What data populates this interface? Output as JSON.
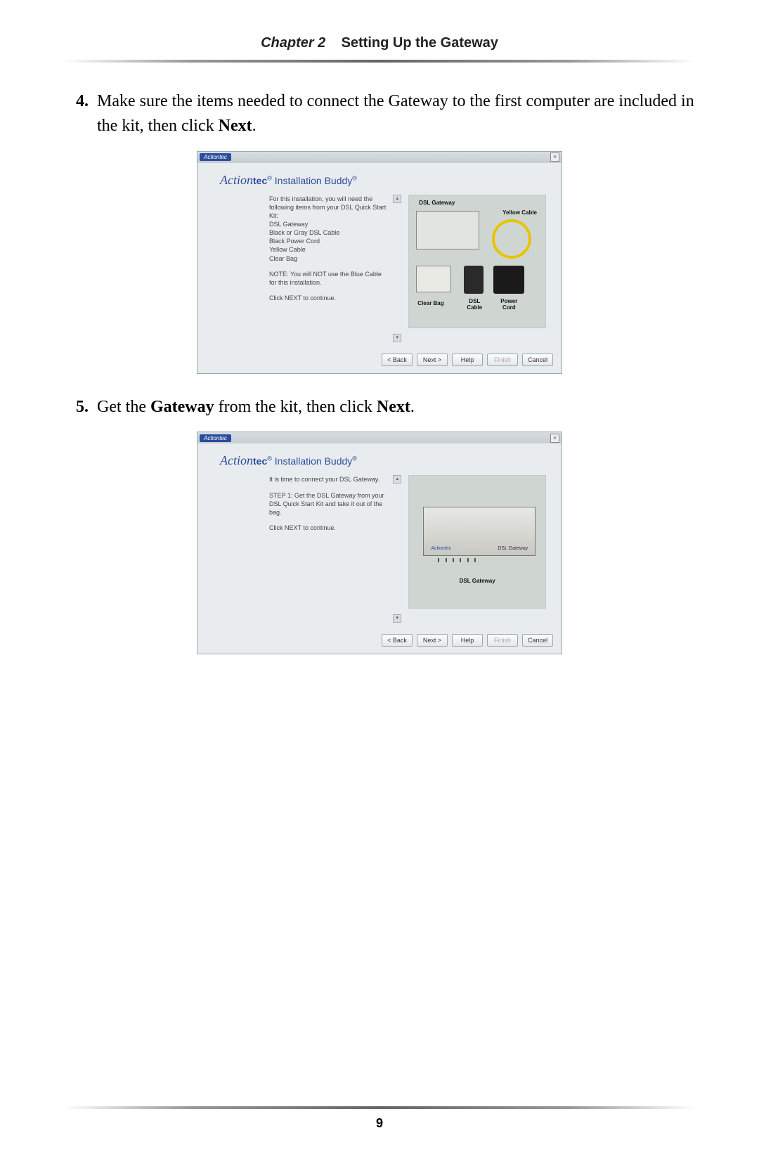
{
  "header": {
    "chapter_label": "Chapter 2",
    "chapter_title": "Setting Up the Gateway"
  },
  "steps": {
    "s4": {
      "num": "4.",
      "text_before": "Make sure the items needed to connect the Gateway to the first computer are included in the kit, then click ",
      "bold": "Next",
      "text_after": "."
    },
    "s5": {
      "num": "5.",
      "text_before": "Get the ",
      "bold1": "Gateway",
      "mid": " from the kit, then click ",
      "bold2": "Next",
      "text_after": "."
    }
  },
  "installer": {
    "brand_chip": "Actiontec",
    "close": "×",
    "logo_cursive": "Action",
    "logo_bold": "tec",
    "logo_reg1": "®",
    "logo_title": " Installation Buddy",
    "logo_reg2": "®",
    "buttons": {
      "back": "< Back",
      "next": "Next >",
      "help": "Help",
      "finish": "Finish",
      "cancel": "Cancel"
    }
  },
  "shot1": {
    "p1": "For this installation, you will need the following items from your DSL Quick Start Kit:",
    "l1": "DSL Gateway",
    "l2": "Black or Gray DSL Cable",
    "l3": "Black Power Cord",
    "l4": "Yellow Cable",
    "l5": "Clear Bag",
    "p2": "NOTE:  You will NOT use the Blue Cable for this installation.",
    "p3": "Click NEXT to continue.",
    "labels": {
      "gateway": "DSL Gateway",
      "yellow": "Yellow Cable",
      "clearbag": "Clear Bag",
      "dslcable": "DSL Cable",
      "powercord": "Power Cord"
    }
  },
  "shot2": {
    "p1": "It is time to connect your DSL Gateway.",
    "p2": "STEP 1:  Get the DSL Gateway from your DSL Quick Start Kit and take it out of the bag.",
    "p3": "Click NEXT to continue.",
    "label": "DSL Gateway"
  },
  "page_number": "9"
}
